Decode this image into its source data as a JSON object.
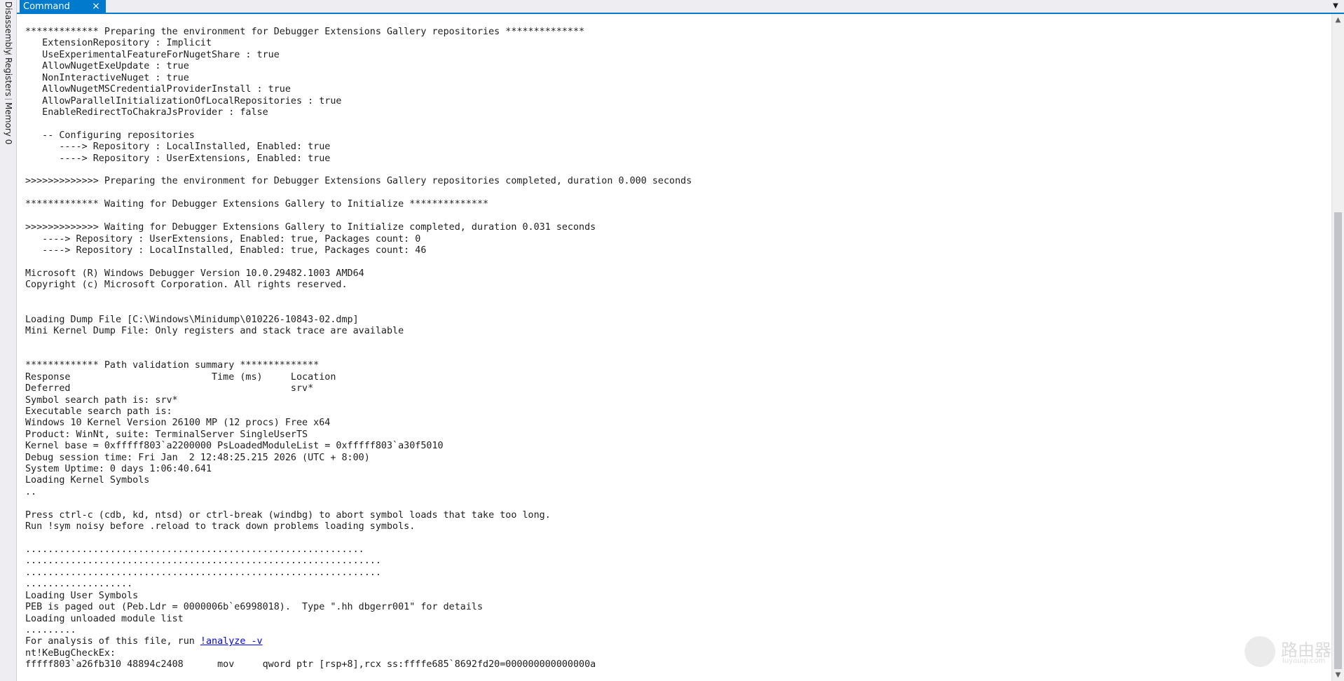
{
  "side_tabs": [
    {
      "label": "Disassembly"
    },
    {
      "label": "Registers"
    },
    {
      "label": "Memory 0"
    }
  ],
  "tab": {
    "label": "Command",
    "close_glyph": "×"
  },
  "dropdown_glyph": "▼",
  "scrollbar": {
    "up_glyph": "▲",
    "down_glyph": "▼",
    "thumb_start": 0.29,
    "thumb_end": 1.0
  },
  "output_lines": [
    "************* Preparing the environment for Debugger Extensions Gallery repositories **************",
    "   ExtensionRepository : Implicit",
    "   UseExperimentalFeatureForNugetShare : true",
    "   AllowNugetExeUpdate : true",
    "   NonInteractiveNuget : true",
    "   AllowNugetMSCredentialProviderInstall : true",
    "   AllowParallelInitializationOfLocalRepositories : true",
    "   EnableRedirectToChakraJsProvider : false",
    "",
    "   -- Configuring repositories",
    "      ----> Repository : LocalInstalled, Enabled: true",
    "      ----> Repository : UserExtensions, Enabled: true",
    "",
    ">>>>>>>>>>>>> Preparing the environment for Debugger Extensions Gallery repositories completed, duration 0.000 seconds",
    "",
    "************* Waiting for Debugger Extensions Gallery to Initialize **************",
    "",
    ">>>>>>>>>>>>> Waiting for Debugger Extensions Gallery to Initialize completed, duration 0.031 seconds",
    "   ----> Repository : UserExtensions, Enabled: true, Packages count: 0",
    "   ----> Repository : LocalInstalled, Enabled: true, Packages count: 46",
    "",
    "Microsoft (R) Windows Debugger Version 10.0.29482.1003 AMD64",
    "Copyright (c) Microsoft Corporation. All rights reserved.",
    "",
    "",
    "Loading Dump File [C:\\Windows\\Minidump\\010226-10843-02.dmp]",
    "Mini Kernel Dump File: Only registers and stack trace are available",
    "",
    "",
    "************* Path validation summary **************",
    "Response                         Time (ms)     Location",
    "Deferred                                       srv*",
    "Symbol search path is: srv*",
    "Executable search path is: ",
    "Windows 10 Kernel Version 26100 MP (12 procs) Free x64",
    "Product: WinNt, suite: TerminalServer SingleUserTS",
    "Kernel base = 0xfffff803`a2200000 PsLoadedModuleList = 0xfffff803`a30f5010",
    "Debug session time: Fri Jan  2 12:48:25.215 2026 (UTC + 8:00)",
    "System Uptime: 0 days 1:06:40.641",
    "Loading Kernel Symbols",
    "..",
    "",
    "Press ctrl-c (cdb, kd, ntsd) or ctrl-break (windbg) to abort symbol loads that take too long.",
    "Run !sym noisy before .reload to track down problems loading symbols.",
    "",
    "............................................................",
    "...............................................................",
    "...............................................................",
    "...................",
    "Loading User Symbols",
    "PEB is paged out (Peb.Ldr = 0000006b`e6998018).  Type \".hh dbgerr001\" for details",
    "Loading unloaded module list",
    ".........",
    "nt!KeBugCheckEx:",
    "fffff803`a26fb310 48894c2408      mov     qword ptr [rsp+8],rcx ss:ffffe685`8692fd20=000000000000000a"
  ],
  "analyze_line": {
    "prefix": "For analysis of this file, run ",
    "link": "!analyze -v",
    "insert_before_index": 53
  },
  "watermark": {
    "text": "路由器",
    "sub": "luyouqi.com"
  }
}
